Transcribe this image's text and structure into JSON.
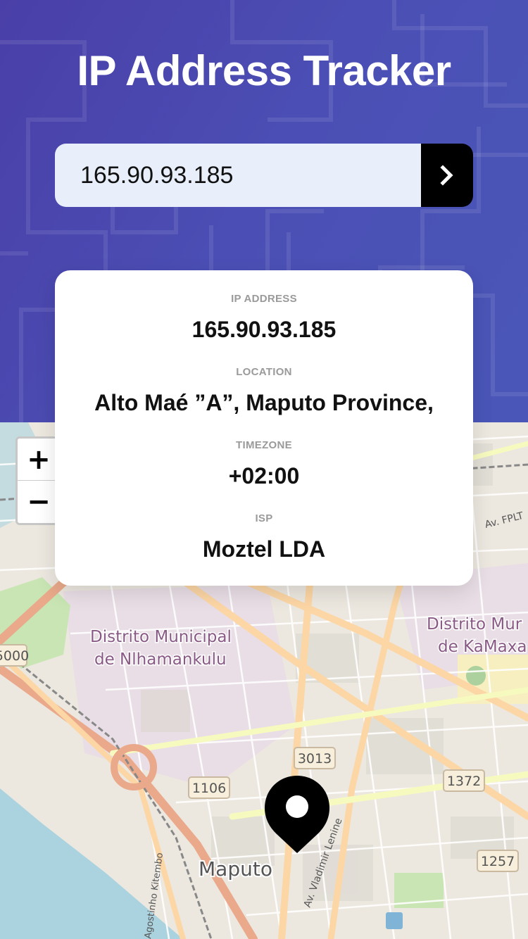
{
  "header": {
    "title": "IP Address Tracker"
  },
  "search": {
    "value": "165.90.93.185",
    "submit_icon": "chevron-right-icon"
  },
  "info": {
    "ip_label": "IP ADDRESS",
    "ip_value": "165.90.93.185",
    "location_label": "LOCATION",
    "location_value": "Alto Maé ”A”, Maputo Province,",
    "timezone_label": "TIMEZONE",
    "timezone_value": "+02:00",
    "isp_label": "ISP",
    "isp_value": "Moztel LDA"
  },
  "map": {
    "zoom_in": "+",
    "zoom_out": "−",
    "labels": {
      "district_1_line1": "Distrito Municipal",
      "district_1_line2": "de Nlhamankulu",
      "district_2_line1": "Distrito Mur",
      "district_2_line2": "de KaMaxa",
      "city": "Maputo",
      "road_3013": "3013",
      "road_1106": "1106",
      "road_1372": "1372",
      "road_1257": "1257",
      "road_5000": "5000",
      "road_avenue": "Av. Vladimir Lenine",
      "road_av_fplt": "Av. FPLT",
      "road_kitembo": "Agostinho Kitembo"
    }
  },
  "colors": {
    "header_bg": "#4b4fb5",
    "input_bg": "#e8effb",
    "button_bg": "#000000",
    "card_bg": "#ffffff",
    "label_gray": "#9a9a9a"
  }
}
